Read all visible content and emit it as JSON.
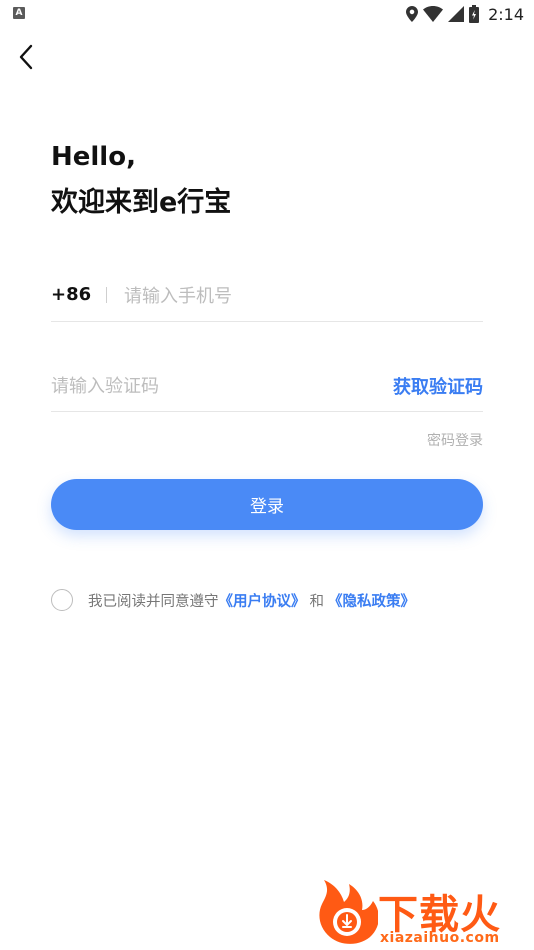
{
  "status_bar": {
    "app_badge": "A",
    "time": "2:14",
    "icons": [
      "location-icon",
      "wifi-icon",
      "signal-icon",
      "battery-icon"
    ]
  },
  "header": {
    "back_icon": "chevron-left-icon"
  },
  "greeting": {
    "line1": "Hello,",
    "line2": "欢迎来到e行宝"
  },
  "phone": {
    "country_code": "+86",
    "placeholder": "请输入手机号",
    "value": ""
  },
  "code": {
    "placeholder": "请输入验证码",
    "value": "",
    "get_code_label": "获取验证码"
  },
  "password_login_label": "密码登录",
  "login_label": "登录",
  "agreement": {
    "checked": false,
    "prefix": "我已阅读并同意遵守",
    "user_agreement": "《用户协议》",
    "conjunction": "和",
    "privacy_policy": "《隐私政策》"
  },
  "watermark": {
    "brand": "下载火",
    "domain": "xiazaihuo.com"
  },
  "colors": {
    "accent": "#3a7df2",
    "button": "#4a8af6",
    "watermark": "#ff5a14"
  }
}
